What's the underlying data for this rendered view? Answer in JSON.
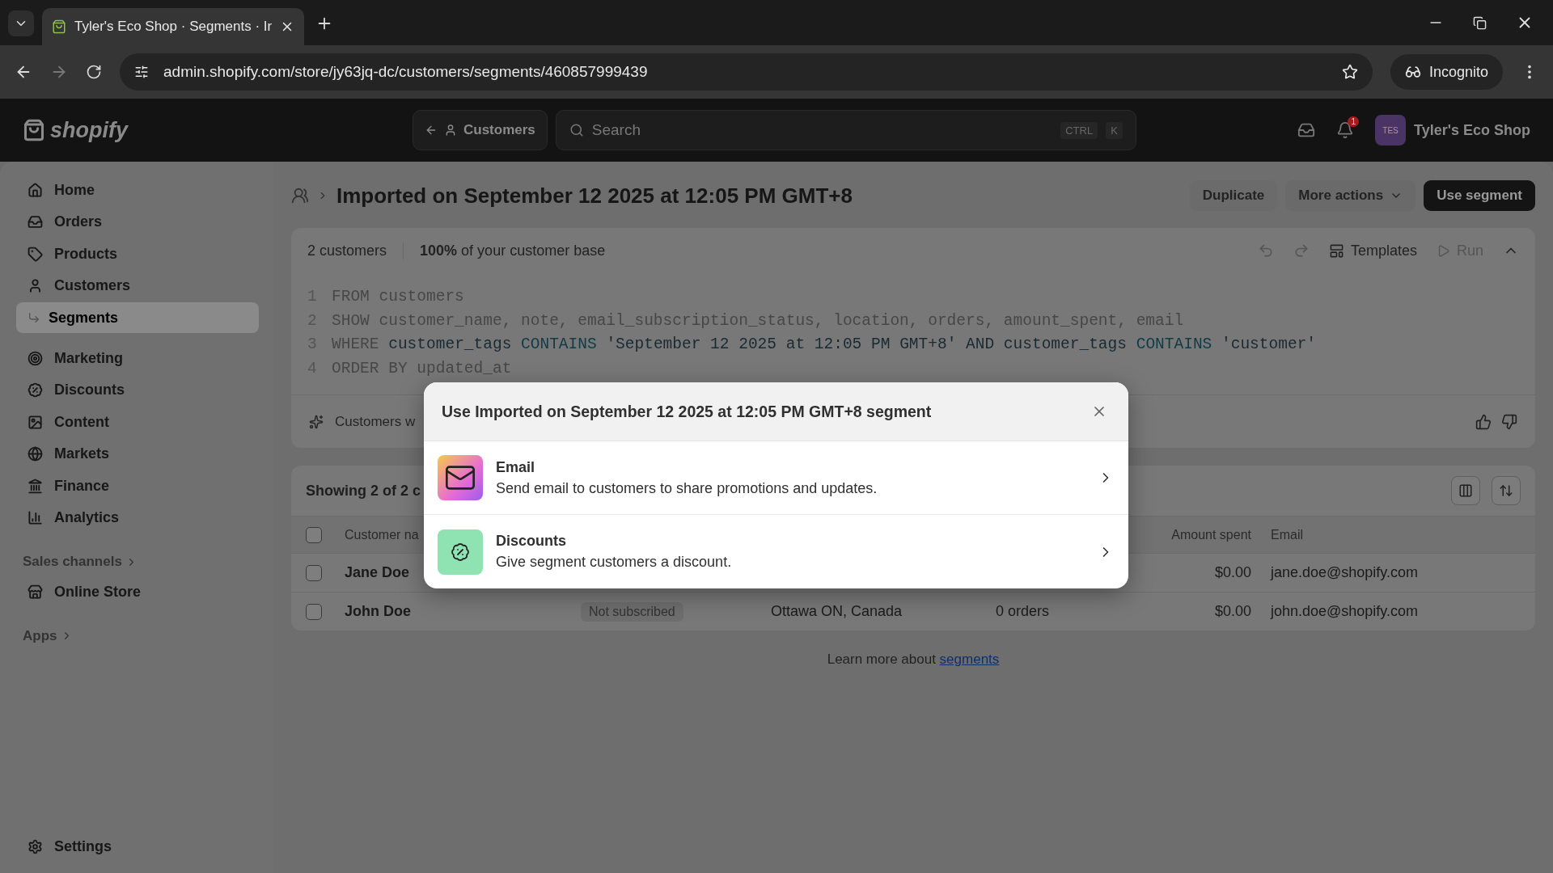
{
  "browser": {
    "tab_title": "Tyler's Eco Shop · Segments · Ir",
    "url": "admin.shopify.com/store/jy63jq-dc/customers/segments/460857999439",
    "profile": "Incognito"
  },
  "topbar": {
    "logo": "shopify",
    "back_label": "Customers",
    "search_placeholder": "Search",
    "shortcut": [
      "CTRL",
      "K"
    ],
    "notification_badge": "1",
    "store_initials": "TES",
    "store_name": "Tyler's Eco Shop"
  },
  "sidebar": {
    "items": [
      {
        "kind": "home",
        "label": "Home",
        "selected": false
      },
      {
        "kind": "orders",
        "label": "Orders",
        "selected": false
      },
      {
        "kind": "products",
        "label": "Products",
        "selected": false
      },
      {
        "kind": "customers",
        "label": "Customers",
        "selected": false
      },
      {
        "kind": "sub",
        "label": "Segments",
        "selected": true
      },
      {
        "kind": "marketing",
        "label": "Marketing",
        "selected": false
      },
      {
        "kind": "discounts",
        "label": "Discounts",
        "selected": false
      },
      {
        "kind": "content",
        "label": "Content",
        "selected": false
      },
      {
        "kind": "markets",
        "label": "Markets",
        "selected": false
      },
      {
        "kind": "finance",
        "label": "Finance",
        "selected": false
      },
      {
        "kind": "analytics",
        "label": "Analytics",
        "selected": false
      }
    ],
    "sales_channels_heading": "Sales channels",
    "channels": [
      "Online Store"
    ],
    "apps_heading": "Apps",
    "settings": "Settings"
  },
  "page": {
    "title": "Imported on September 12 2025 at 12:05 PM GMT+8",
    "buttons": [
      {
        "kind": "plain",
        "label": "Duplicate"
      },
      {
        "kind": "menu",
        "label": "More actions"
      },
      {
        "kind": "primary",
        "label": "Use segment"
      }
    ]
  },
  "editor": {
    "customer_count": "2 customers",
    "base_share_value": "100%",
    "base_share_text": "of your customer base",
    "templates": "Templates",
    "run": "Run",
    "lines": [
      {
        "number": "1",
        "tokens": [
          {
            "kind": "dim",
            "text": "FROM customers"
          }
        ]
      },
      {
        "number": "2",
        "tokens": [
          {
            "kind": "dim",
            "text": "SHOW customer_name, note, email_subscription_status, location, orders, amount_spent, email"
          }
        ]
      },
      {
        "number": "3",
        "tokens": [
          {
            "kind": "dim",
            "text": "WHERE "
          },
          {
            "kind": "field",
            "text": "customer_tags "
          },
          {
            "kind": "op",
            "text": "CONTAINS "
          },
          {
            "kind": "field",
            "text": "'September 12 2025 at 12:05 PM GMT+8' AND customer_tags "
          },
          {
            "kind": "op",
            "text": "CONTAINS "
          },
          {
            "kind": "field",
            "text": "'customer'"
          }
        ]
      },
      {
        "number": "4",
        "tokens": [
          {
            "kind": "dim",
            "text": "ORDER BY updated_at"
          }
        ]
      }
    ],
    "summary": "Customers w"
  },
  "table": {
    "showing": "Showing 2 of 2 c",
    "select_all_checked": false,
    "columns": [
      "Customer na",
      "Amount spent",
      "Email"
    ],
    "rows": [
      {
        "checked": false,
        "name": "Jane Doe",
        "amount": "$0.00",
        "email": "jane.doe@shopify.com"
      },
      {
        "checked": false,
        "name": "John Doe",
        "subscription": "Not subscribed",
        "location": "Ottawa ON, Canada",
        "orders": "0 orders",
        "amount": "$0.00",
        "email": "john.doe@shopify.com"
      }
    ]
  },
  "footer": {
    "text": "Learn more about",
    "link": "segments"
  },
  "modal": {
    "title": "Use Imported on September 12 2025 at 12:05 PM GMT+8 segment",
    "options": [
      {
        "kind": "email",
        "title": "Email",
        "description": "Send email to customers to share promotions and updates."
      },
      {
        "kind": "discount",
        "title": "Discounts",
        "description": "Give segment customers a discount."
      }
    ]
  }
}
